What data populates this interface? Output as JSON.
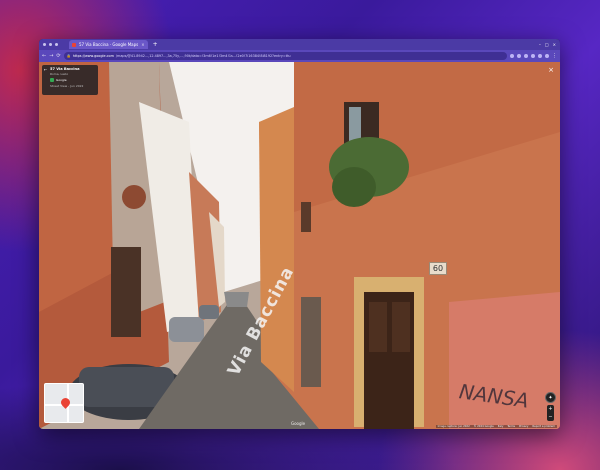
{
  "browser": {
    "tab_title": "57 Via Baccina · Google Maps",
    "tab_close": "×",
    "new_tab": "+",
    "url_host": "https://www.google.com",
    "url_path": "/maps/@41.8942...,12.4897...,3a,75y,...,90t/data=!3m6!1e1!3m4!1s...!2e0!7i16384!8i8192?entry=ttu",
    "back": "←",
    "forward": "→",
    "reload": "⟳"
  },
  "street_view": {
    "card_back": "←",
    "card_title": "57 Via Baccina",
    "card_subtitle": "Roma, Lazio",
    "card_row": "Google",
    "card_date": "Street View - Jun 2022",
    "close": "×",
    "street_name_painted": "Via Baccina",
    "house_number": "60",
    "graffiti_text": "NANSA",
    "google_mark": "Google",
    "footer": [
      "Image capture: Jun 2022",
      "© 2024 Google",
      "Italy",
      "Terms",
      "Privacy",
      "Report a problem"
    ],
    "zoom_in": "+",
    "zoom_out": "−"
  },
  "colors": {
    "facade_right": "#c9744d",
    "facade_left": "#b45a3c",
    "sky": "#f4f1ee",
    "browser_chrome": "#5a48bb"
  }
}
